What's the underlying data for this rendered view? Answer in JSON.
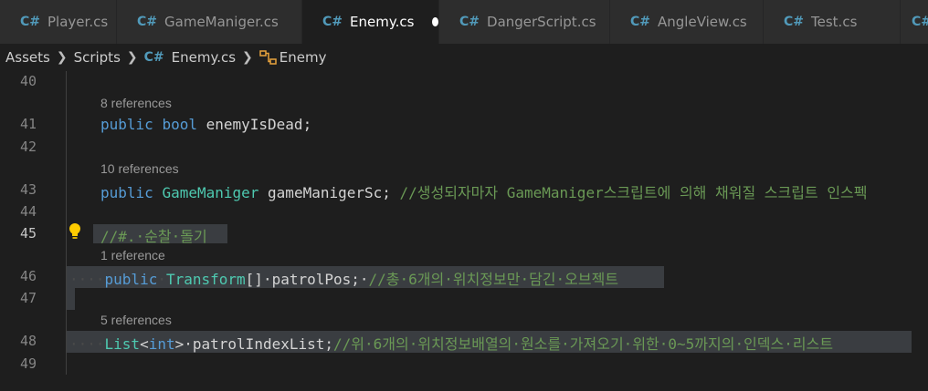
{
  "tabs": [
    {
      "label": "Player.cs",
      "active": false,
      "width": 128
    },
    {
      "label": "GameManiger.cs",
      "active": false,
      "width": 203
    },
    {
      "label": "Enemy.cs",
      "active": true,
      "width": 150
    },
    {
      "label": "DangerScript.cs",
      "active": false,
      "width": 187
    },
    {
      "label": "AngleView.cs",
      "active": false,
      "width": 168
    },
    {
      "label": "Test.cs",
      "active": false,
      "width": 150
    }
  ],
  "breadcrumb": {
    "assets": "Assets",
    "scripts": "Scripts",
    "file": "Enemy.cs",
    "symbol": "Enemy"
  },
  "editor": {
    "line_numbers": [
      "40",
      "41",
      "42",
      "43",
      "44",
      "45",
      "46",
      "47",
      "48",
      "49"
    ],
    "references": {
      "ref41": "8 references",
      "ref43": "10 references",
      "ref46": "1 reference",
      "ref48": "5 references"
    },
    "line41": {
      "kw1": "public",
      "kw2": "bool",
      "rest": " enemyIsDead;"
    },
    "line43": {
      "kw1": "public",
      "type": "GameManiger",
      "rest": " gameManigerSc; ",
      "comment": "//생성되자마자 GameManiger스크립트에 의해 채워질 스크립트 인스펙"
    },
    "line45": {
      "comment": "//#.·순찰·돌기"
    },
    "line46": {
      "indent": "····",
      "kw1": "public",
      "type": "Transform",
      "rest": "[]·patrolPos;·",
      "comment": "//총·6개의·위치정보만·담긴·오브젝트"
    },
    "line48": {
      "indent": "····",
      "type": "List",
      "lt": "<",
      "kw": "int",
      "gt": ">",
      "rest": "·patrolIndexList;",
      "comment": "//위·6개의·위치정보배열의·원소를·가져오기·위한·0~5까지의·인덱스·리스트"
    }
  },
  "colors": {
    "keyword": "#569cd6",
    "type": "#4ec9b0",
    "comment": "#6a9955",
    "csharp_icon": "#519aba",
    "class_icon": "#e8a33d"
  },
  "icons": {
    "csharp": "C#",
    "lightbulb": "lightbulb-icon",
    "class": "class-icon"
  }
}
